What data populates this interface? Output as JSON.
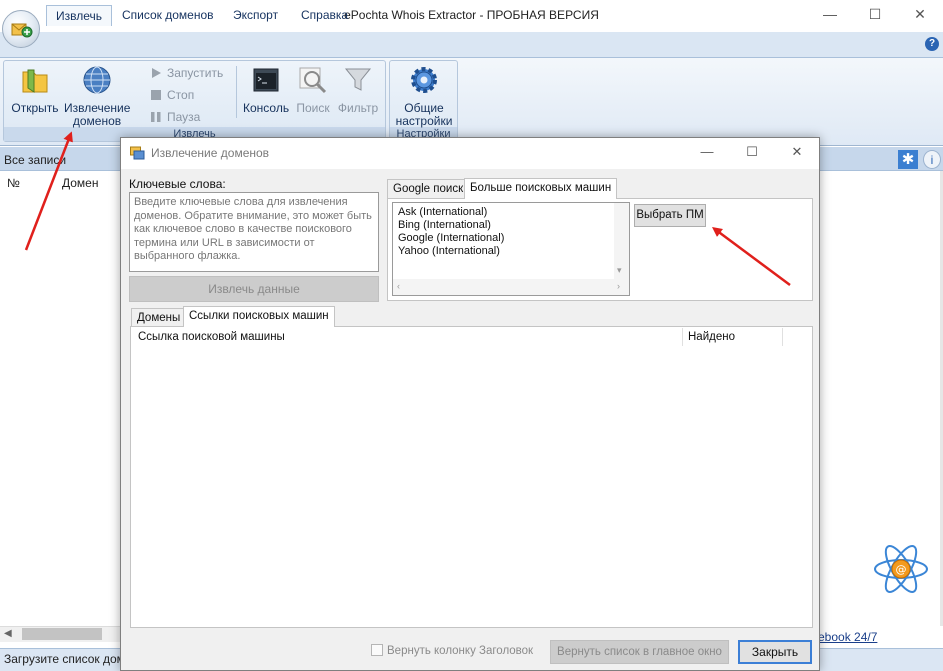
{
  "window": {
    "title": "ePochta Whois Extractor - ПРОБНАЯ ВЕРСИЯ",
    "minimize": "—",
    "maximize": "☐",
    "close": "✕"
  },
  "menu": {
    "tabs": [
      "Извлечь",
      "Список доменов",
      "Экспорт",
      "Справка"
    ],
    "help": "?"
  },
  "ribbon": {
    "open_label": "Открыть",
    "extract_domains_label_1": "Извлечение",
    "extract_domains_label_2": "доменов",
    "start_label": "Запустить",
    "stop_label": "Стоп",
    "pause_label": "Пауза",
    "console_label": "Консоль",
    "search_label": "Поиск",
    "filter_label": "Фильтр",
    "settings_label_1": "Общие",
    "settings_label_2": "настройки",
    "group_extract": "Извлечь",
    "group_settings": "Настройки"
  },
  "list": {
    "header": "Все записи",
    "col_num": "№",
    "col_domain": "Домен"
  },
  "status": {
    "text": "Загрузите список доме",
    "facebook_link": "ebook 24/7"
  },
  "dialog": {
    "title": "Извлечение доменов",
    "keywords_label": "Ключевые слова:",
    "keywords_placeholder": "Введите ключевые слова для извлечения доменов. Обратите внимание, это может быть как ключевое слово в качестве поискового термина или URL в зависимости от выбранного флажка.",
    "extract_button": "Извлечь данные",
    "search_tabs": [
      "Google поиск",
      "Больше поисковых машин"
    ],
    "search_engines": [
      "Ask (International)",
      "Bing (International)",
      "Google (International)",
      "Yahoo (International)"
    ],
    "choose_button": "Выбрать ПМ",
    "result_tabs": [
      "Домены",
      "Ссылки поисковых машин"
    ],
    "col_link": "Ссылка поисковой машины",
    "col_found": "Найдено",
    "return_column_label": "Вернуть колонку Заголовок",
    "return_main_button": "Вернуть список в главное окно",
    "close_button": "Закрыть"
  },
  "colors": {
    "accent": "#3c7fd6",
    "ribbon_bg": "#dae6f3",
    "arrow": "#e0201c"
  }
}
